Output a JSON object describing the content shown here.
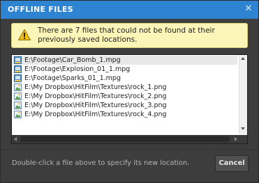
{
  "dialog": {
    "title": "OFFLINE FILES",
    "close_glyph": "✕"
  },
  "warning": {
    "icon": "warning-icon",
    "text": "There are 7 files that could not be found at their previously saved locations."
  },
  "files": [
    {
      "name": "E:\\Footage\\Car_Bomb_1.mpg",
      "icon": "video-file-icon",
      "selected": true
    },
    {
      "name": "E:\\Footage\\Explosion_01_1.mpg",
      "icon": "video-file-icon",
      "selected": false
    },
    {
      "name": "E:\\Footage\\Sparks_01_1.mpg",
      "icon": "video-file-icon",
      "selected": false
    },
    {
      "name": "E:\\My Dropbox\\HitFilm\\Textures\\rock_1.png",
      "icon": "image-file-icon",
      "selected": false
    },
    {
      "name": "E:\\My Dropbox\\HitFilm\\Textures\\rock_2.png",
      "icon": "image-file-icon",
      "selected": false
    },
    {
      "name": "E:\\My Dropbox\\HitFilm\\Textures\\rock_3.png",
      "icon": "image-file-icon",
      "selected": false
    },
    {
      "name": "E:\\My Dropbox\\HitFilm\\Textures\\rock_4.png",
      "icon": "image-file-icon",
      "selected": false
    }
  ],
  "footer": {
    "hint": "Double-click a file above to specify its new location.",
    "cancel_label": "Cancel"
  },
  "colors": {
    "titlebar": "#2f84d2",
    "warning_bg": "#fbf5b7",
    "dialog_bg": "#3d3d3d"
  }
}
